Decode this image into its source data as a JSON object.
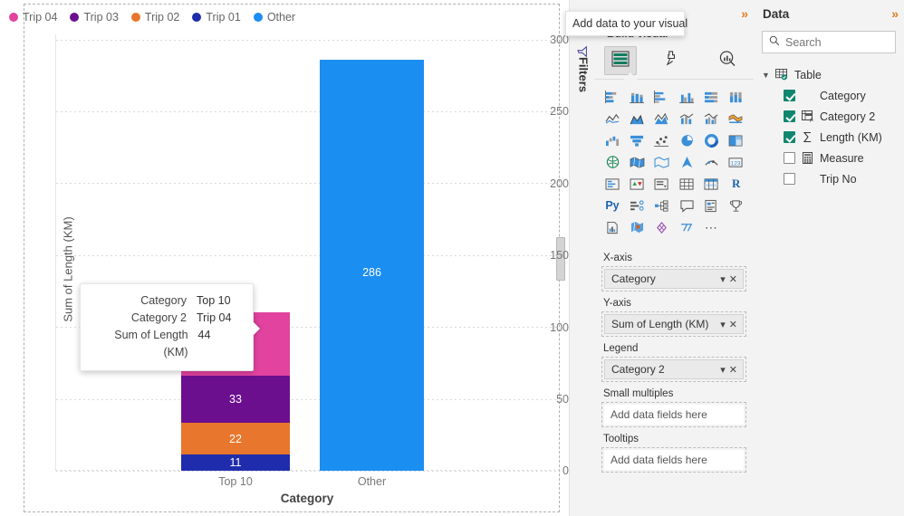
{
  "chart_data": {
    "type": "bar",
    "subtype": "stacked-column",
    "title": "",
    "xlabel": "Category",
    "ylabel": "Sum of Length (KM)",
    "categories": [
      "Top 10",
      "Other"
    ],
    "ylim": [
      0,
      300
    ],
    "yticks": [
      300,
      250,
      200,
      150,
      100,
      50,
      0
    ],
    "grid": true,
    "legend_position": "top",
    "series": [
      {
        "name": "Trip 04",
        "color": "#e1439f",
        "values": [
          44,
          0
        ],
        "labels": [
          "",
          ""
        ]
      },
      {
        "name": "Trip 03",
        "color": "#6b0f8f",
        "values": [
          33,
          0
        ],
        "labels": [
          "33",
          ""
        ]
      },
      {
        "name": "Trip 02",
        "color": "#e8762c",
        "values": [
          22,
          0
        ],
        "labels": [
          "22",
          ""
        ]
      },
      {
        "name": "Trip 01",
        "color": "#1f2dad",
        "values": [
          11,
          0
        ],
        "labels": [
          "11",
          ""
        ]
      },
      {
        "name": "Other",
        "color": "#1b8ef2",
        "values": [
          0,
          286
        ],
        "labels": [
          "",
          "286"
        ]
      }
    ]
  },
  "legend": {
    "items": [
      {
        "label": "Trip 04",
        "color": "#e1439f"
      },
      {
        "label": "Trip 03",
        "color": "#6b0f8f"
      },
      {
        "label": "Trip 02",
        "color": "#e8762c"
      },
      {
        "label": "Trip 01",
        "color": "#1f2dad"
      },
      {
        "label": "Other",
        "color": "#1b8ef2"
      }
    ]
  },
  "chart_tooltip": {
    "rows": [
      {
        "key": "Category",
        "value": "Top 10"
      },
      {
        "key": "Category 2",
        "value": "Trip 04"
      },
      {
        "key": "Sum of Length (KM)",
        "value": "44"
      }
    ]
  },
  "pane_tooltip": {
    "text": "Add data to your visual"
  },
  "filters_pane": {
    "title": "Filters",
    "icon": "filter-funnel-icon"
  },
  "visualizations_pane": {
    "title_partial": "ns",
    "expand_icon": "chevron-double-right-icon",
    "build_label": "Build visual",
    "tabs": [
      {
        "name": "build-visual",
        "icon": "table-fields-icon",
        "selected": true
      },
      {
        "name": "format-visual",
        "icon": "paintbrush-icon",
        "selected": false
      },
      {
        "name": "analytics",
        "icon": "magnifier-chart-icon",
        "selected": false
      }
    ],
    "viz_icons": [
      "stacked-bar-chart-icon",
      "stacked-column-chart-icon",
      "clustered-bar-chart-icon",
      "clustered-column-chart-icon",
      "hundred-percent-stacked-bar-icon",
      "hundred-percent-stacked-column-icon",
      "line-chart-icon",
      "area-chart-icon",
      "stacked-area-chart-icon",
      "line-stacked-column-icon",
      "line-clustered-column-icon",
      "ribbon-chart-icon",
      "waterfall-chart-icon",
      "funnel-chart-icon",
      "scatter-chart-icon",
      "pie-chart-icon",
      "donut-chart-icon",
      "treemap-icon",
      "map-icon",
      "filled-map-icon",
      "azure-map-icon",
      "shape-map-icon",
      "arcgis-map-icon",
      "card-icon",
      "multi-row-card-icon",
      "kpi-icon",
      "slicer-icon",
      "table-icon",
      "matrix-icon",
      "r-script-visual-icon",
      "python-visual-icon",
      "key-influencers-icon",
      "decomposition-tree-icon",
      "qna-icon",
      "smart-narrative-icon",
      "metrics-icon",
      "paginated-report-icon",
      "power-apps-icon",
      "power-automate-icon",
      "arcgis-icon",
      "more-options-icon"
    ],
    "wells": [
      {
        "label": "X-axis",
        "value": "Category",
        "empty": false
      },
      {
        "label": "Y-axis",
        "value": "Sum of Length (KM)",
        "empty": false
      },
      {
        "label": "Legend",
        "value": "Category 2",
        "empty": false
      },
      {
        "label": "Small multiples",
        "value": "Add data fields here",
        "empty": true
      },
      {
        "label": "Tooltips",
        "value": "Add data fields here",
        "empty": true
      }
    ]
  },
  "data_pane": {
    "title": "Data",
    "expand_icon": "chevron-double-right-icon",
    "search_placeholder": "Search",
    "table": {
      "name": "Table",
      "expanded": true
    },
    "fields": [
      {
        "name": "Category",
        "checked": true,
        "icon": ""
      },
      {
        "name": "Category 2",
        "checked": true,
        "icon": "calculated-column-icon"
      },
      {
        "name": "Length (KM)",
        "checked": true,
        "icon": "sigma-icon"
      },
      {
        "name": "Measure",
        "checked": false,
        "icon": "calculator-icon"
      },
      {
        "name": "Trip No",
        "checked": false,
        "icon": ""
      }
    ]
  }
}
